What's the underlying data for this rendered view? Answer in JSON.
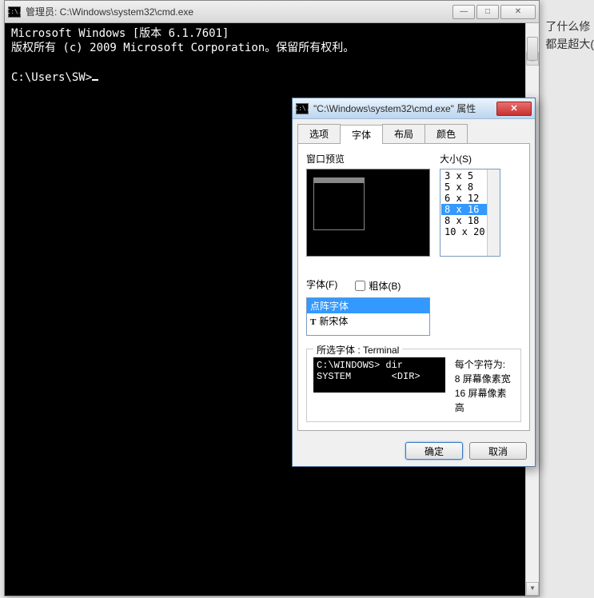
{
  "bg_text": {
    "line1": "了什么修",
    "line2": "都是超大("
  },
  "cmd": {
    "icon": "C:\\.",
    "title": "管理员: C:\\Windows\\system32\\cmd.exe",
    "line1": "Microsoft Windows [版本 6.1.7601]",
    "line2": "版权所有 (c) 2009 Microsoft Corporation。保留所有权利。",
    "prompt": "C:\\Users\\SW>",
    "min": "—",
    "max": "□",
    "close": "✕"
  },
  "props": {
    "icon": "C:\\.",
    "title": "\"C:\\Windows\\system32\\cmd.exe\" 属性",
    "close": "✕",
    "tabs": {
      "options": "选项",
      "font": "字体",
      "layout": "布局",
      "color": "颜色"
    },
    "preview_label": "窗口预览",
    "size_label": "大小(S)",
    "sizes": [
      {
        "label": " 3 x  5",
        "selected": false
      },
      {
        "label": " 5 x  8",
        "selected": false
      },
      {
        "label": " 6 x 12",
        "selected": false
      },
      {
        "label": " 8 x 16",
        "selected": true
      },
      {
        "label": " 8 x 18",
        "selected": false
      },
      {
        "label": "10 x 20",
        "selected": false
      }
    ],
    "font_label": "字体(F)",
    "bold_label": "粗体(B)",
    "fonts": [
      {
        "label": "点阵字体",
        "selected": true,
        "tt": false
      },
      {
        "label": "新宋体",
        "selected": false,
        "tt": true
      }
    ],
    "group_title": "所选字体 : Terminal",
    "sample": "C:\\WINDOWS> dir\nSYSTEM       <DIR>",
    "char_info_label": "每个字符为:",
    "char_w": "8 屏幕像素宽",
    "char_h": "16 屏幕像素高",
    "ok": "确定",
    "cancel": "取消"
  }
}
